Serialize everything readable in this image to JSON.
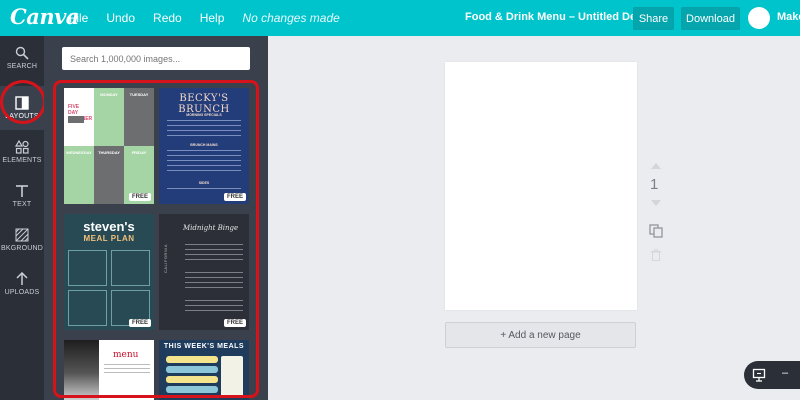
{
  "topbar": {
    "logo": "Canva",
    "menu": [
      {
        "label": "File"
      },
      {
        "label": "Undo"
      },
      {
        "label": "Redo"
      },
      {
        "label": "Help"
      }
    ],
    "status": "No changes made",
    "doc_title": "Food & Drink Menu – Untitled Design",
    "share_label": "Share",
    "download_label": "Download",
    "make_label": "Make"
  },
  "rail": {
    "items": [
      {
        "label": "SEARCH",
        "icon": "search-icon"
      },
      {
        "label": "LAYOUTS",
        "icon": "layouts-icon"
      },
      {
        "label": "ELEMENTS",
        "icon": "elements-icon"
      },
      {
        "label": "TEXT",
        "icon": "text-icon"
      },
      {
        "label": "BKGROUND",
        "icon": "background-icon"
      },
      {
        "label": "UPLOADS",
        "icon": "upload-icon"
      }
    ]
  },
  "panel": {
    "search_placeholder": "Search 1,000,000 images...",
    "free_label": "FREE",
    "templates": [
      {
        "name": "Five Day Planner",
        "title": "FIVE DAY PLANNER",
        "days": [
          "MONDAY",
          "TUESDAY",
          "WEDNESDAY",
          "THURSDAY",
          "FRIDAY"
        ]
      },
      {
        "name": "Becky's Brunch",
        "title": "BECKY'S BRUNCH",
        "sections": [
          "MORNING SPECIALS",
          "BRUNCH MAINS",
          "SIDES"
        ]
      },
      {
        "name": "Steven's Meal Plan",
        "title": "steven's",
        "subtitle": "MEAL PLAN"
      },
      {
        "name": "Midnight Binge",
        "title": "Midnight Binge",
        "side_text": "CALIFORNIA"
      },
      {
        "name": "Menu",
        "title": "menu"
      },
      {
        "name": "This Week's Meals",
        "title": "THIS WEEK'S MEALS"
      }
    ]
  },
  "canvas": {
    "page_number": "1",
    "add_page_label": "+ Add a new page"
  },
  "colors": {
    "brand_teal": "#00c4cc",
    "rail_bg": "#2a2f38",
    "panel_bg": "#3b414c",
    "highlight_red": "#d6131a"
  }
}
